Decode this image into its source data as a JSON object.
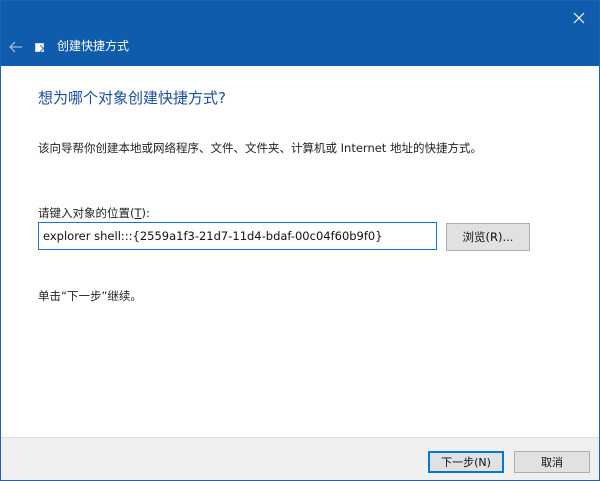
{
  "window": {
    "title": "创建快捷方式",
    "close_icon": "close-icon",
    "back_icon": "back-arrow-icon"
  },
  "main": {
    "heading": "想为哪个对象创建快捷方式?",
    "description": "该向导帮你创建本地或网络程序、文件、文件夹、计算机或 Internet 地址的快捷方式。",
    "field_label_prefix": "请键入对象的位置(",
    "field_label_key": "T",
    "field_label_suffix": "):",
    "path_value": "explorer shell:::{2559a1f3-21d7-11d4-bdaf-00c04f60b9f0}",
    "browse_label": "浏览(R)...",
    "hint": "单击“下一步”继续。"
  },
  "footer": {
    "next_label": "下一步(N)",
    "cancel_label": "取消"
  },
  "colors": {
    "titlebar": "#0e5cab",
    "heading": "#1b4fa3",
    "focus_border": "#0078d7"
  }
}
